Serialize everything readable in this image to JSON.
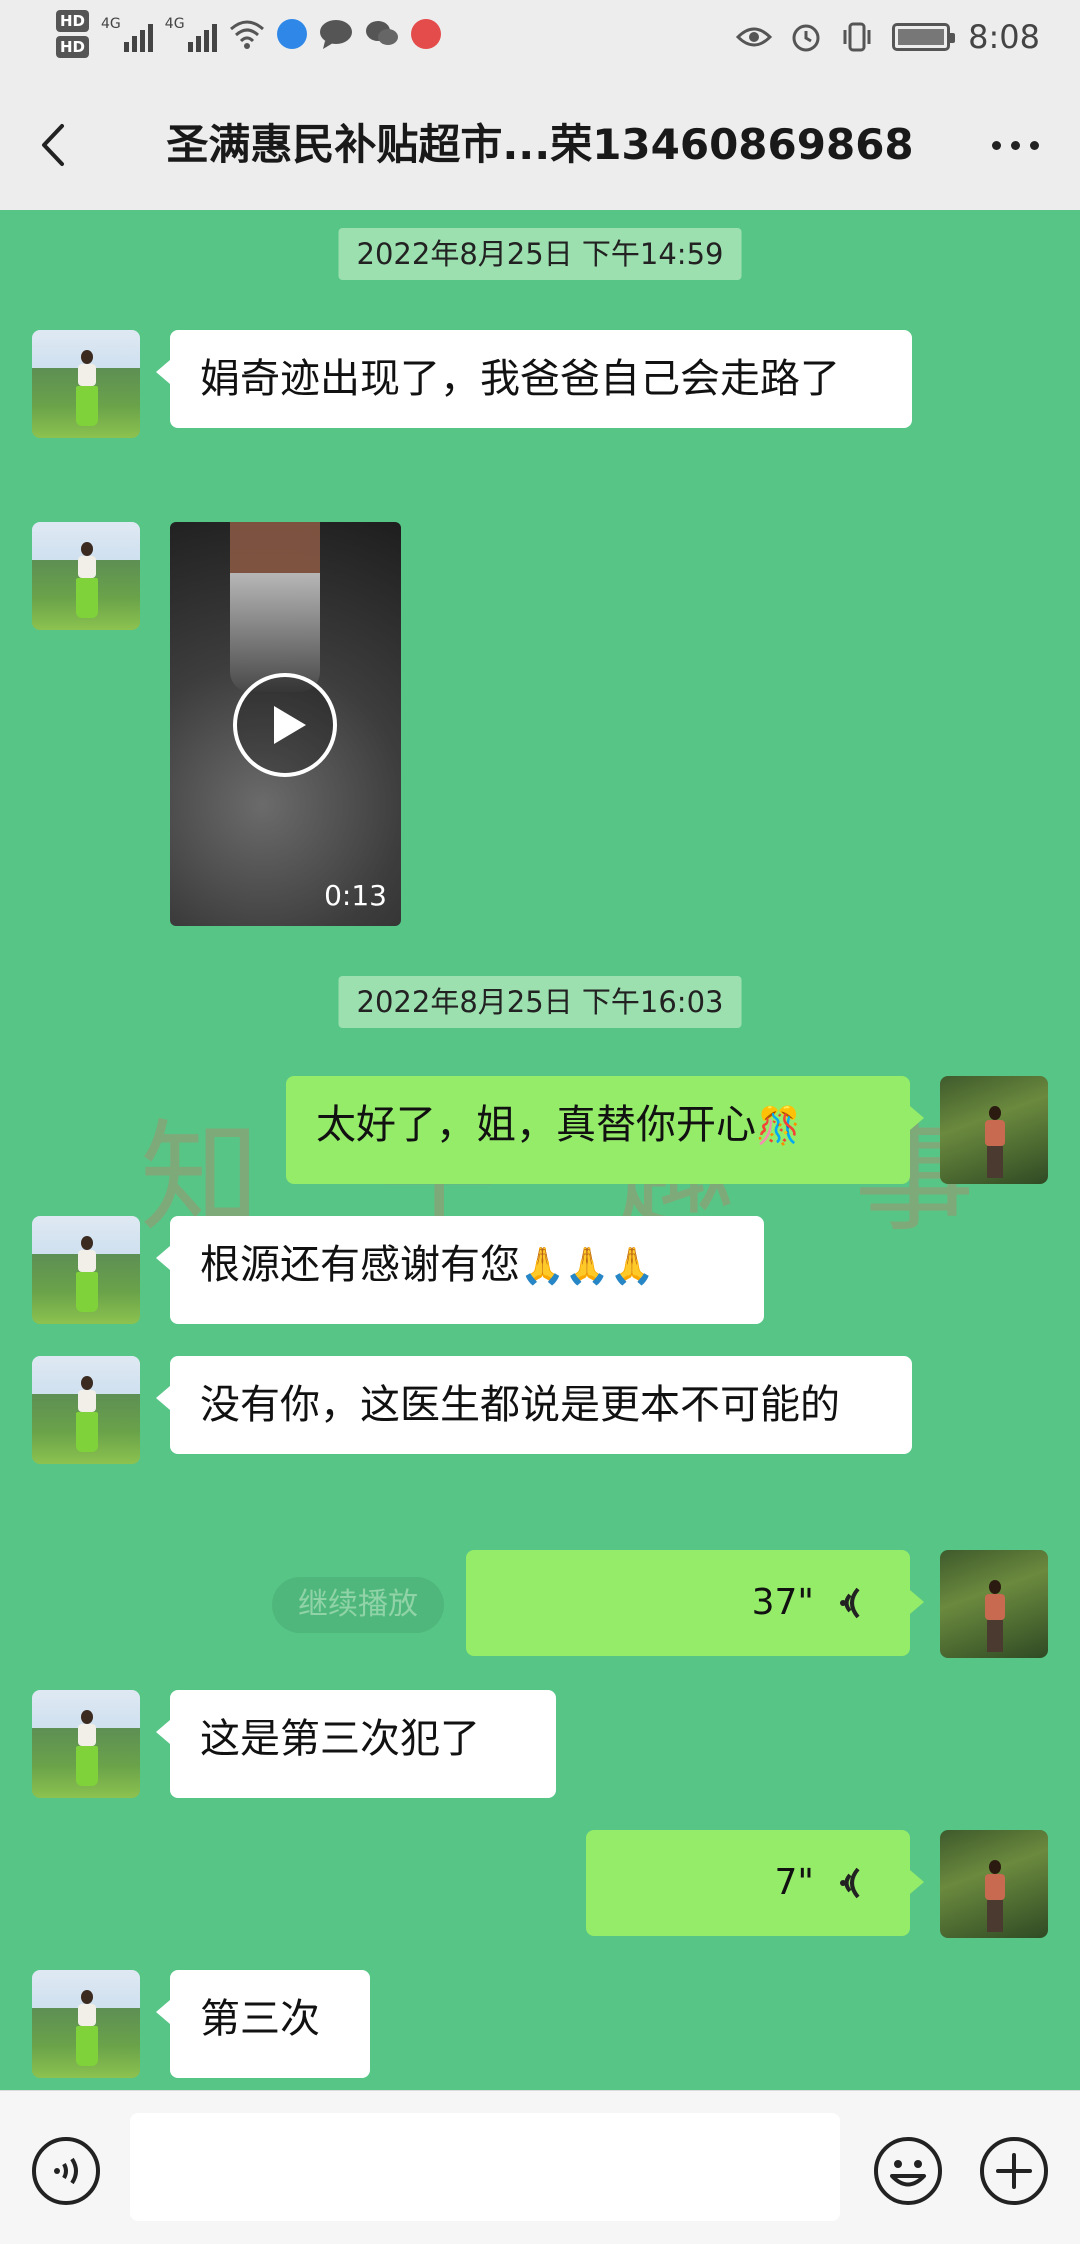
{
  "status_bar": {
    "hd1": "HD",
    "hd2": "HD",
    "network1": "4G",
    "network2": "4G",
    "time": "8:08"
  },
  "header": {
    "title": "圣满惠民补贴超市...荣13460869868"
  },
  "messages": {
    "ts1": "2022年8月25日 下午14:59",
    "m1": "娟奇迹出现了，我爸爸自己会走路了",
    "video_duration": "0:13",
    "ts2": "2022年8月25日 下午16:03",
    "m2": "太好了，姐，真替你开心",
    "m2_emoji": "🎊",
    "m3": "根源还有感谢有您",
    "m3_emoji": "🙏🙏🙏",
    "m4": "没有你，这医生都说是更本不可能的",
    "continue_play": "继续播放",
    "voice1": "37\"",
    "m5": "这是第三次犯了",
    "voice2": "7\"",
    "m6": "第三次"
  },
  "input": {
    "placeholder": ""
  },
  "icons": {
    "back": "chevron-left-icon",
    "more": "more-dots-icon",
    "play": "play-icon",
    "voice": "voice-wave-icon",
    "emoji": "smiley-icon",
    "plus": "plus-circle-icon"
  },
  "colors": {
    "chat_background": "#57c586",
    "outgoing_bubble": "#95ec69",
    "incoming_bubble": "#ffffff",
    "header_background": "#ededed"
  }
}
